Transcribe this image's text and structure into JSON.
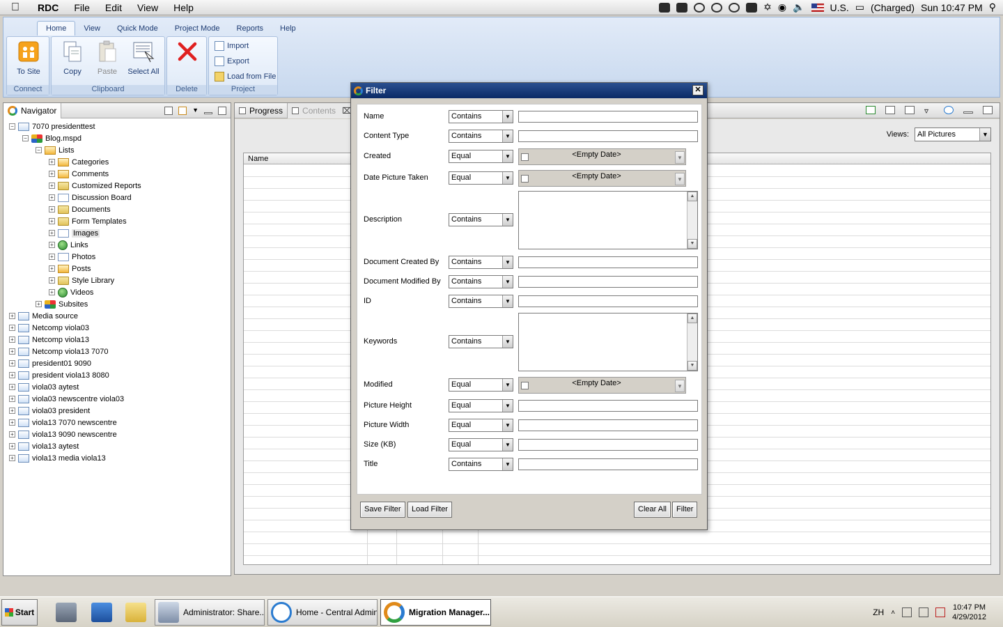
{
  "macbar": {
    "app_name": "RDC",
    "menus": [
      "File",
      "Edit",
      "View",
      "Help"
    ],
    "keyboard": "U.S.",
    "battery": "(Charged)",
    "clock": "Sun 10:47 PM"
  },
  "ribbon": {
    "tabs": [
      "Home",
      "View",
      "Quick Mode",
      "Project Mode",
      "Reports",
      "Help"
    ],
    "active_tab": "Home",
    "groups": {
      "connect": {
        "label": "Connect",
        "to_site": "To Site"
      },
      "clipboard": {
        "label": "Clipboard",
        "copy": "Copy",
        "paste": "Paste",
        "select_all": "Select All"
      },
      "delete": {
        "label": "Delete"
      },
      "project": {
        "label": "Project",
        "import": "Import",
        "export": "Export",
        "load_from_file": "Load from File"
      }
    }
  },
  "navigator": {
    "title": "Navigator",
    "tree": [
      {
        "label": "7070 presidenttest",
        "icon": "open-folder",
        "level": 0,
        "expanded": true
      },
      {
        "label": "Blog.mspd",
        "icon": "site",
        "level": 1,
        "expanded": true
      },
      {
        "label": "Lists",
        "icon": "list-folder",
        "level": 2,
        "expanded": true
      },
      {
        "label": "Categories",
        "icon": "list",
        "level": 3
      },
      {
        "label": "Comments",
        "icon": "list",
        "level": 3
      },
      {
        "label": "Customized Reports",
        "icon": "doc-folder",
        "level": 3
      },
      {
        "label": "Discussion Board",
        "icon": "doc",
        "level": 3
      },
      {
        "label": "Documents",
        "icon": "doc-folder",
        "level": 3
      },
      {
        "label": "Form Templates",
        "icon": "doc-folder",
        "level": 3
      },
      {
        "label": "Images",
        "icon": "image",
        "level": 3,
        "selected": true
      },
      {
        "label": "Links",
        "icon": "globe",
        "level": 3
      },
      {
        "label": "Photos",
        "icon": "image",
        "level": 3
      },
      {
        "label": "Posts",
        "icon": "list",
        "level": 3
      },
      {
        "label": "Style Library",
        "icon": "doc-folder",
        "level": 3
      },
      {
        "label": "Videos",
        "icon": "globe",
        "level": 3
      },
      {
        "label": "Subsites",
        "icon": "site",
        "level": 2
      },
      {
        "label": "Media source",
        "icon": "open-folder",
        "level": 0
      },
      {
        "label": "Netcomp viola03",
        "icon": "open-folder",
        "level": 0
      },
      {
        "label": "Netcomp viola13",
        "icon": "open-folder",
        "level": 0
      },
      {
        "label": "Netcomp viola13 7070",
        "icon": "open-folder",
        "level": 0
      },
      {
        "label": "president01 9090",
        "icon": "open-folder",
        "level": 0
      },
      {
        "label": "president viola13 8080",
        "icon": "open-folder",
        "level": 0
      },
      {
        "label": "viola03 aytest",
        "icon": "open-folder",
        "level": 0
      },
      {
        "label": "viola03 newscentre viola03",
        "icon": "open-folder",
        "level": 0
      },
      {
        "label": "viola03 president",
        "icon": "open-folder",
        "level": 0
      },
      {
        "label": "viola13 7070 newscentre",
        "icon": "open-folder",
        "level": 0
      },
      {
        "label": "viola13 9090 newscentre",
        "icon": "open-folder",
        "level": 0
      },
      {
        "label": "viola13 aytest",
        "icon": "open-folder",
        "level": 0
      },
      {
        "label": "viola13 media viola13",
        "icon": "open-folder",
        "level": 0
      }
    ]
  },
  "content": {
    "tabs": [
      "Progress",
      "Contents"
    ],
    "views_label": "Views:",
    "views_value": "All Pictures",
    "grid_header": "Name"
  },
  "filter": {
    "title": "Filter",
    "rows": [
      {
        "label": "Name",
        "operator": "Contains",
        "kind": "text"
      },
      {
        "label": "Content Type",
        "operator": "Contains",
        "kind": "text"
      },
      {
        "label": "Created",
        "operator": "Equal",
        "kind": "date",
        "value": "<Empty Date>"
      },
      {
        "label": "Date Picture Taken",
        "operator": "Equal",
        "kind": "date",
        "value": "<Empty Date>"
      },
      {
        "label": "Description",
        "operator": "Contains",
        "kind": "area"
      },
      {
        "label": "Document Created By",
        "operator": "Contains",
        "kind": "text"
      },
      {
        "label": "Document Modified By",
        "operator": "Contains",
        "kind": "text"
      },
      {
        "label": "ID",
        "operator": "Contains",
        "kind": "text"
      },
      {
        "label": "Keywords",
        "operator": "Contains",
        "kind": "area"
      },
      {
        "label": "Modified",
        "operator": "Equal",
        "kind": "date",
        "value": "<Empty Date>"
      },
      {
        "label": "Picture Height",
        "operator": "Equal",
        "kind": "text"
      },
      {
        "label": "Picture Width",
        "operator": "Equal",
        "kind": "text"
      },
      {
        "label": "Size (KB)",
        "operator": "Equal",
        "kind": "text"
      },
      {
        "label": "Title",
        "operator": "Contains",
        "kind": "text"
      }
    ],
    "buttons": {
      "save": "Save Filter",
      "load": "Load Filter",
      "clear": "Clear All",
      "apply": "Filter"
    }
  },
  "taskbar": {
    "start": "Start",
    "windows": [
      {
        "label": "Administrator: Share...",
        "active": false
      },
      {
        "label": "Home - Central Admin...",
        "active": false
      },
      {
        "label": "Migration Manager...",
        "active": true
      }
    ],
    "lang": "ZH",
    "time": "10:47 PM",
    "date": "4/29/2012"
  }
}
